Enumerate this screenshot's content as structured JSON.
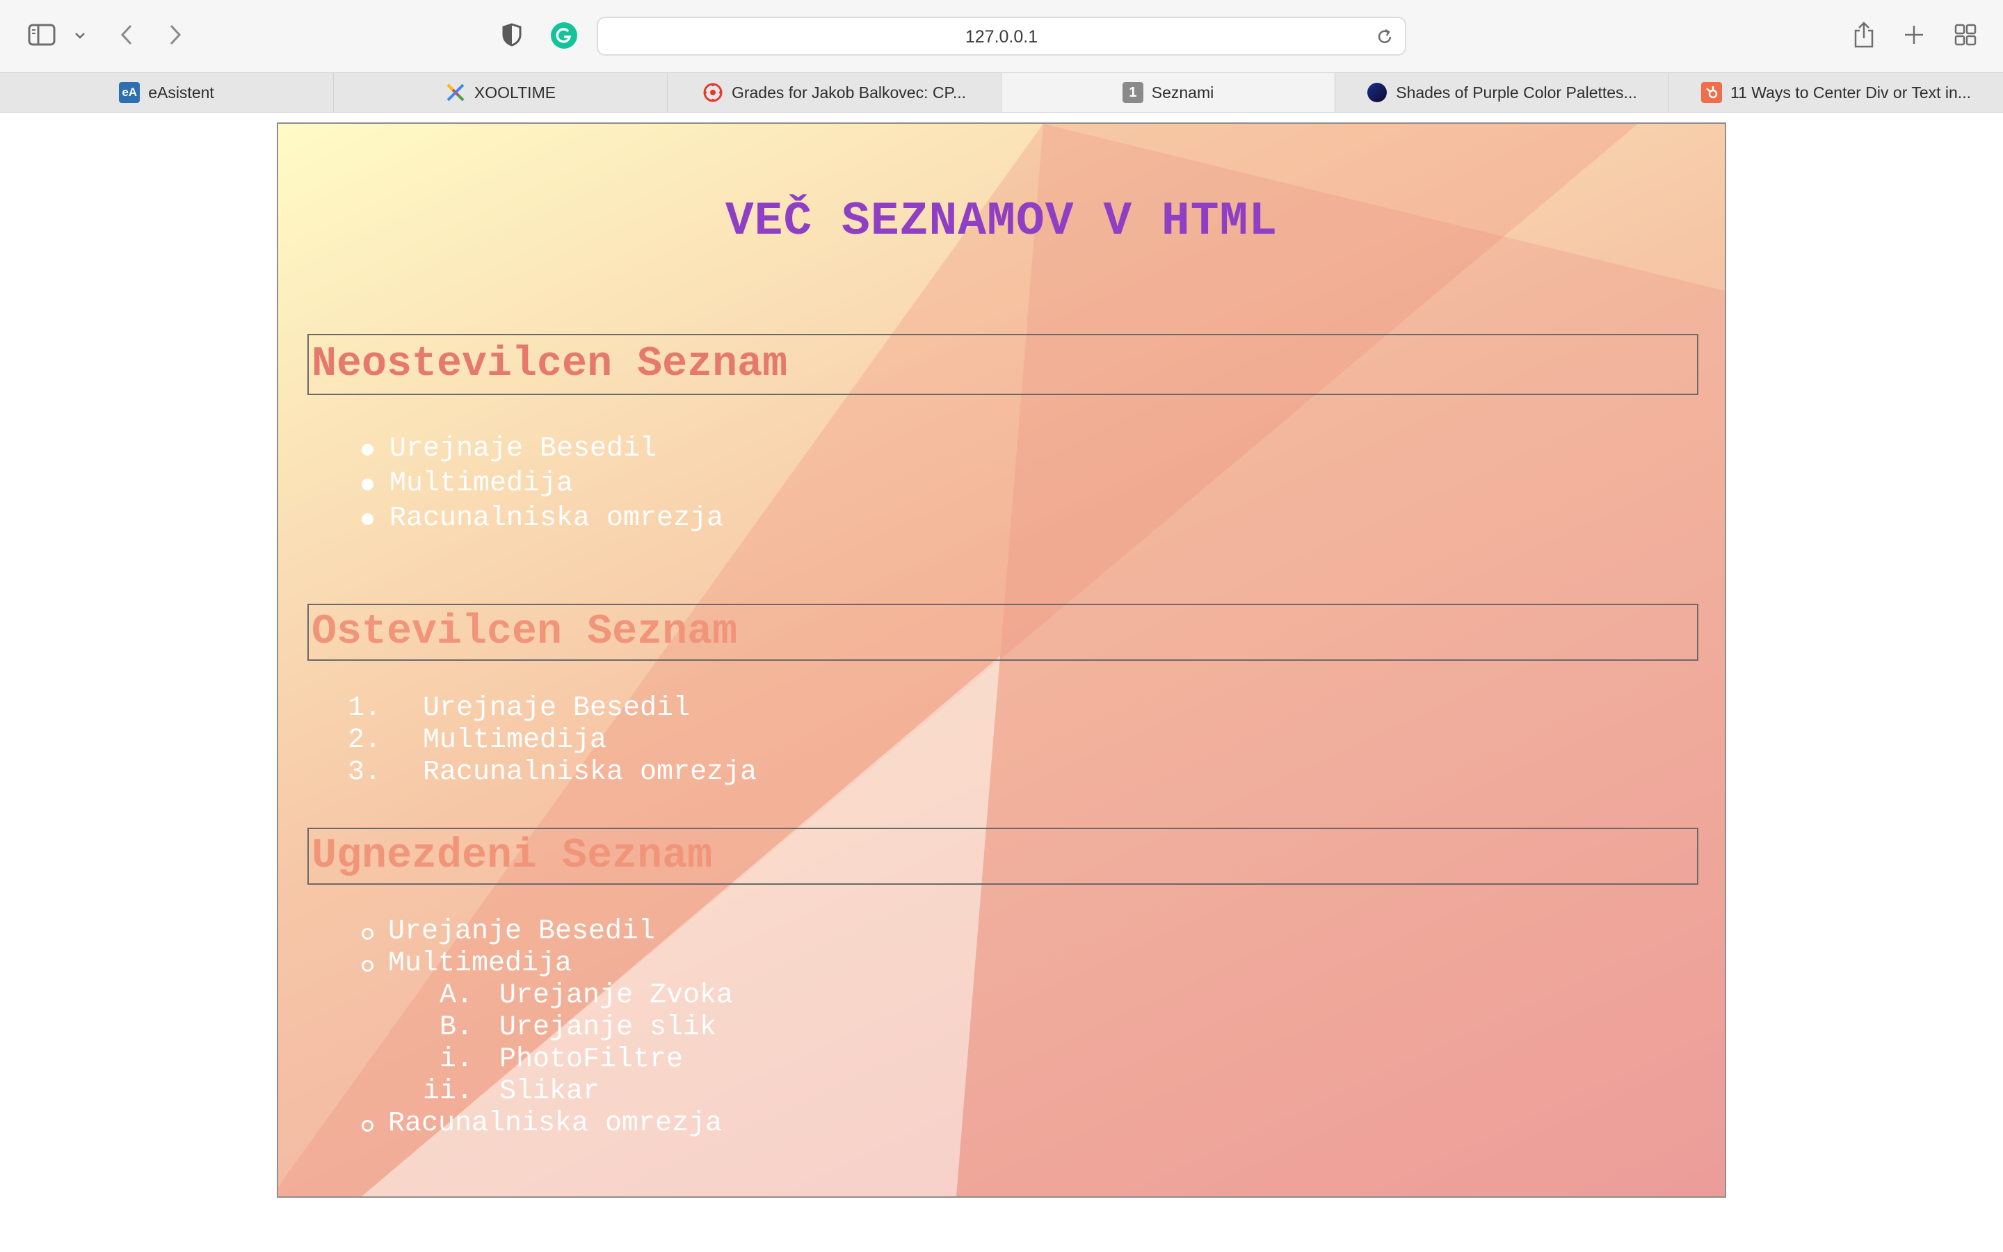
{
  "browser": {
    "url": "127.0.0.1",
    "tabs": [
      {
        "label": "eAsistent",
        "icon": "easistent-icon",
        "active": false
      },
      {
        "label": "XOOLTIME",
        "icon": "xooltime-icon",
        "active": false
      },
      {
        "label": "Grades for Jakob Balkovec: CP...",
        "icon": "canvas-icon",
        "active": false
      },
      {
        "label": "Seznami",
        "icon": "tab-number-icon",
        "badge": "1",
        "active": true
      },
      {
        "label": "Shades of Purple Color Palettes...",
        "icon": "palette-icon",
        "active": false
      },
      {
        "label": "11 Ways to Center Div or Text in...",
        "icon": "hubspot-icon",
        "active": false
      }
    ]
  },
  "page": {
    "title": "VEČ SEZNAMOV V HTML",
    "unordered": {
      "heading": "Neostevilcen Seznam",
      "items": [
        "Urejnaje Besedil",
        "Multimedija",
        "Racunalniska omrezja"
      ]
    },
    "ordered": {
      "heading": "Ostevilcen Seznam",
      "markers": [
        "1.",
        "2.",
        "3."
      ],
      "items": [
        "Urejnaje Besedil",
        "Multimedija",
        "Racunalniska omrezja"
      ]
    },
    "nested": {
      "heading": "Ugnezdeni Seznam",
      "items": [
        "Urejanje Besedil",
        "Multimedija",
        "Racunalniska omrezja"
      ],
      "sub_markers": [
        "A.",
        "B.",
        "i.",
        "ii."
      ],
      "sub_items": [
        "Urejanje Zvoka",
        "Urejanje slik",
        "PhotoFiltre",
        "Slikar"
      ]
    }
  },
  "colors": {
    "title": "#8f3fc4",
    "heading": "#eb8168",
    "list_text": "#ffffff"
  }
}
